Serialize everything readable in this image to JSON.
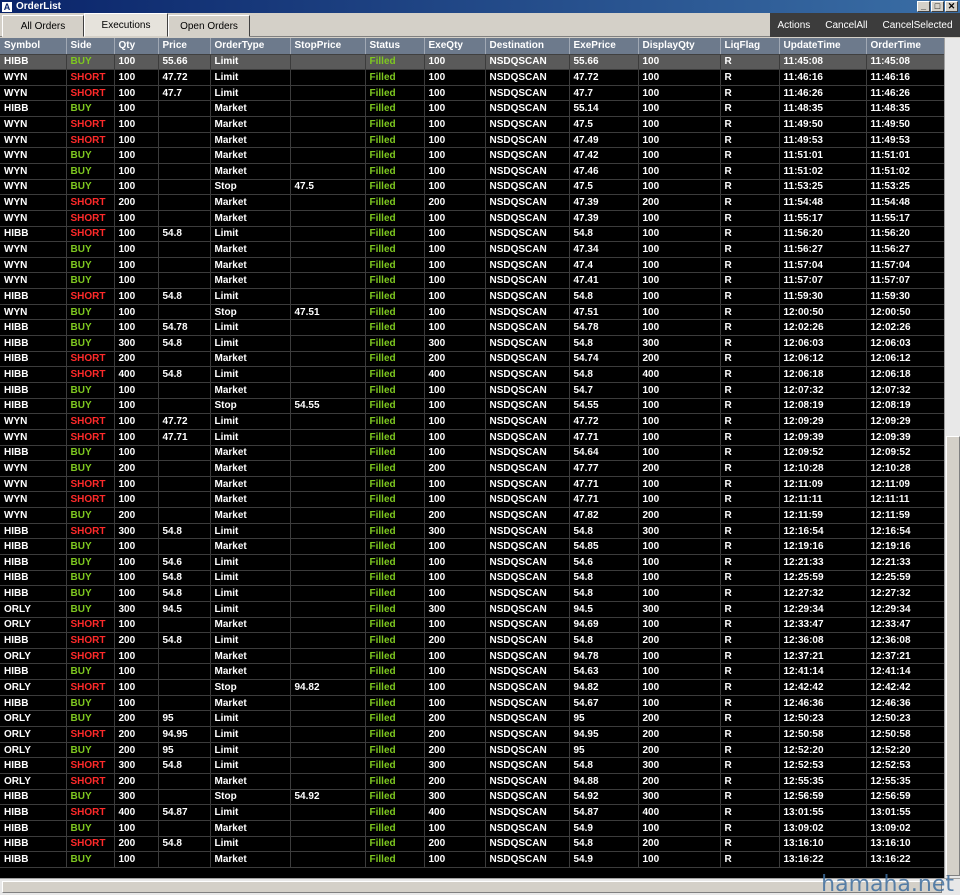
{
  "window": {
    "title": "OrderList",
    "icon": "A"
  },
  "tabs": [
    {
      "label": "All Orders"
    },
    {
      "label": "Executions"
    },
    {
      "label": "Open Orders"
    }
  ],
  "actions": [
    "Actions",
    "CancelAll",
    "CancelSelected"
  ],
  "columns": [
    "Symbol",
    "Side",
    "Qty",
    "Price",
    "OrderType",
    "StopPrice",
    "Status",
    "ExeQty",
    "Destination",
    "ExePrice",
    "DisplayQty",
    "LiqFlag",
    "UpdateTime",
    "OrderTime"
  ],
  "rows": [
    [
      "HIBB",
      "BUY",
      "100",
      "55.66",
      "Limit",
      "",
      "Filled",
      "100",
      "NSDQSCAN",
      "55.66",
      "100",
      "R",
      "11:45:08",
      "11:45:08"
    ],
    [
      "WYN",
      "SHORT",
      "100",
      "47.72",
      "Limit",
      "",
      "Filled",
      "100",
      "NSDQSCAN",
      "47.72",
      "100",
      "R",
      "11:46:16",
      "11:46:16"
    ],
    [
      "WYN",
      "SHORT",
      "100",
      "47.7",
      "Limit",
      "",
      "Filled",
      "100",
      "NSDQSCAN",
      "47.7",
      "100",
      "R",
      "11:46:26",
      "11:46:26"
    ],
    [
      "HIBB",
      "BUY",
      "100",
      "",
      "Market",
      "",
      "Filled",
      "100",
      "NSDQSCAN",
      "55.14",
      "100",
      "R",
      "11:48:35",
      "11:48:35"
    ],
    [
      "WYN",
      "SHORT",
      "100",
      "",
      "Market",
      "",
      "Filled",
      "100",
      "NSDQSCAN",
      "47.5",
      "100",
      "R",
      "11:49:50",
      "11:49:50"
    ],
    [
      "WYN",
      "SHORT",
      "100",
      "",
      "Market",
      "",
      "Filled",
      "100",
      "NSDQSCAN",
      "47.49",
      "100",
      "R",
      "11:49:53",
      "11:49:53"
    ],
    [
      "WYN",
      "BUY",
      "100",
      "",
      "Market",
      "",
      "Filled",
      "100",
      "NSDQSCAN",
      "47.42",
      "100",
      "R",
      "11:51:01",
      "11:51:01"
    ],
    [
      "WYN",
      "BUY",
      "100",
      "",
      "Market",
      "",
      "Filled",
      "100",
      "NSDQSCAN",
      "47.46",
      "100",
      "R",
      "11:51:02",
      "11:51:02"
    ],
    [
      "WYN",
      "BUY",
      "100",
      "",
      "Stop",
      "47.5",
      "Filled",
      "100",
      "NSDQSCAN",
      "47.5",
      "100",
      "R",
      "11:53:25",
      "11:53:25"
    ],
    [
      "WYN",
      "SHORT",
      "200",
      "",
      "Market",
      "",
      "Filled",
      "200",
      "NSDQSCAN",
      "47.39",
      "200",
      "R",
      "11:54:48",
      "11:54:48"
    ],
    [
      "WYN",
      "SHORT",
      "100",
      "",
      "Market",
      "",
      "Filled",
      "100",
      "NSDQSCAN",
      "47.39",
      "100",
      "R",
      "11:55:17",
      "11:55:17"
    ],
    [
      "HIBB",
      "SHORT",
      "100",
      "54.8",
      "Limit",
      "",
      "Filled",
      "100",
      "NSDQSCAN",
      "54.8",
      "100",
      "R",
      "11:56:20",
      "11:56:20"
    ],
    [
      "WYN",
      "BUY",
      "100",
      "",
      "Market",
      "",
      "Filled",
      "100",
      "NSDQSCAN",
      "47.34",
      "100",
      "R",
      "11:56:27",
      "11:56:27"
    ],
    [
      "WYN",
      "BUY",
      "100",
      "",
      "Market",
      "",
      "Filled",
      "100",
      "NSDQSCAN",
      "47.4",
      "100",
      "R",
      "11:57:04",
      "11:57:04"
    ],
    [
      "WYN",
      "BUY",
      "100",
      "",
      "Market",
      "",
      "Filled",
      "100",
      "NSDQSCAN",
      "47.41",
      "100",
      "R",
      "11:57:07",
      "11:57:07"
    ],
    [
      "HIBB",
      "SHORT",
      "100",
      "54.8",
      "Limit",
      "",
      "Filled",
      "100",
      "NSDQSCAN",
      "54.8",
      "100",
      "R",
      "11:59:30",
      "11:59:30"
    ],
    [
      "WYN",
      "BUY",
      "100",
      "",
      "Stop",
      "47.51",
      "Filled",
      "100",
      "NSDQSCAN",
      "47.51",
      "100",
      "R",
      "12:00:50",
      "12:00:50"
    ],
    [
      "HIBB",
      "BUY",
      "100",
      "54.78",
      "Limit",
      "",
      "Filled",
      "100",
      "NSDQSCAN",
      "54.78",
      "100",
      "R",
      "12:02:26",
      "12:02:26"
    ],
    [
      "HIBB",
      "BUY",
      "300",
      "54.8",
      "Limit",
      "",
      "Filled",
      "300",
      "NSDQSCAN",
      "54.8",
      "300",
      "R",
      "12:06:03",
      "12:06:03"
    ],
    [
      "HIBB",
      "SHORT",
      "200",
      "",
      "Market",
      "",
      "Filled",
      "200",
      "NSDQSCAN",
      "54.74",
      "200",
      "R",
      "12:06:12",
      "12:06:12"
    ],
    [
      "HIBB",
      "SHORT",
      "400",
      "54.8",
      "Limit",
      "",
      "Filled",
      "400",
      "NSDQSCAN",
      "54.8",
      "400",
      "R",
      "12:06:18",
      "12:06:18"
    ],
    [
      "HIBB",
      "BUY",
      "100",
      "",
      "Market",
      "",
      "Filled",
      "100",
      "NSDQSCAN",
      "54.7",
      "100",
      "R",
      "12:07:32",
      "12:07:32"
    ],
    [
      "HIBB",
      "BUY",
      "100",
      "",
      "Stop",
      "54.55",
      "Filled",
      "100",
      "NSDQSCAN",
      "54.55",
      "100",
      "R",
      "12:08:19",
      "12:08:19"
    ],
    [
      "WYN",
      "SHORT",
      "100",
      "47.72",
      "Limit",
      "",
      "Filled",
      "100",
      "NSDQSCAN",
      "47.72",
      "100",
      "R",
      "12:09:29",
      "12:09:29"
    ],
    [
      "WYN",
      "SHORT",
      "100",
      "47.71",
      "Limit",
      "",
      "Filled",
      "100",
      "NSDQSCAN",
      "47.71",
      "100",
      "R",
      "12:09:39",
      "12:09:39"
    ],
    [
      "HIBB",
      "BUY",
      "100",
      "",
      "Market",
      "",
      "Filled",
      "100",
      "NSDQSCAN",
      "54.64",
      "100",
      "R",
      "12:09:52",
      "12:09:52"
    ],
    [
      "WYN",
      "BUY",
      "200",
      "",
      "Market",
      "",
      "Filled",
      "200",
      "NSDQSCAN",
      "47.77",
      "200",
      "R",
      "12:10:28",
      "12:10:28"
    ],
    [
      "WYN",
      "SHORT",
      "100",
      "",
      "Market",
      "",
      "Filled",
      "100",
      "NSDQSCAN",
      "47.71",
      "100",
      "R",
      "12:11:09",
      "12:11:09"
    ],
    [
      "WYN",
      "SHORT",
      "100",
      "",
      "Market",
      "",
      "Filled",
      "100",
      "NSDQSCAN",
      "47.71",
      "100",
      "R",
      "12:11:11",
      "12:11:11"
    ],
    [
      "WYN",
      "BUY",
      "200",
      "",
      "Market",
      "",
      "Filled",
      "200",
      "NSDQSCAN",
      "47.82",
      "200",
      "R",
      "12:11:59",
      "12:11:59"
    ],
    [
      "HIBB",
      "SHORT",
      "300",
      "54.8",
      "Limit",
      "",
      "Filled",
      "300",
      "NSDQSCAN",
      "54.8",
      "300",
      "R",
      "12:16:54",
      "12:16:54"
    ],
    [
      "HIBB",
      "BUY",
      "100",
      "",
      "Market",
      "",
      "Filled",
      "100",
      "NSDQSCAN",
      "54.85",
      "100",
      "R",
      "12:19:16",
      "12:19:16"
    ],
    [
      "HIBB",
      "BUY",
      "100",
      "54.6",
      "Limit",
      "",
      "Filled",
      "100",
      "NSDQSCAN",
      "54.6",
      "100",
      "R",
      "12:21:33",
      "12:21:33"
    ],
    [
      "HIBB",
      "BUY",
      "100",
      "54.8",
      "Limit",
      "",
      "Filled",
      "100",
      "NSDQSCAN",
      "54.8",
      "100",
      "R",
      "12:25:59",
      "12:25:59"
    ],
    [
      "HIBB",
      "BUY",
      "100",
      "54.8",
      "Limit",
      "",
      "Filled",
      "100",
      "NSDQSCAN",
      "54.8",
      "100",
      "R",
      "12:27:32",
      "12:27:32"
    ],
    [
      "ORLY",
      "BUY",
      "300",
      "94.5",
      "Limit",
      "",
      "Filled",
      "300",
      "NSDQSCAN",
      "94.5",
      "300",
      "R",
      "12:29:34",
      "12:29:34"
    ],
    [
      "ORLY",
      "SHORT",
      "100",
      "",
      "Market",
      "",
      "Filled",
      "100",
      "NSDQSCAN",
      "94.69",
      "100",
      "R",
      "12:33:47",
      "12:33:47"
    ],
    [
      "HIBB",
      "SHORT",
      "200",
      "54.8",
      "Limit",
      "",
      "Filled",
      "200",
      "NSDQSCAN",
      "54.8",
      "200",
      "R",
      "12:36:08",
      "12:36:08"
    ],
    [
      "ORLY",
      "SHORT",
      "100",
      "",
      "Market",
      "",
      "Filled",
      "100",
      "NSDQSCAN",
      "94.78",
      "100",
      "R",
      "12:37:21",
      "12:37:21"
    ],
    [
      "HIBB",
      "BUY",
      "100",
      "",
      "Market",
      "",
      "Filled",
      "100",
      "NSDQSCAN",
      "54.63",
      "100",
      "R",
      "12:41:14",
      "12:41:14"
    ],
    [
      "ORLY",
      "SHORT",
      "100",
      "",
      "Stop",
      "94.82",
      "Filled",
      "100",
      "NSDQSCAN",
      "94.82",
      "100",
      "R",
      "12:42:42",
      "12:42:42"
    ],
    [
      "HIBB",
      "BUY",
      "100",
      "",
      "Market",
      "",
      "Filled",
      "100",
      "NSDQSCAN",
      "54.67",
      "100",
      "R",
      "12:46:36",
      "12:46:36"
    ],
    [
      "ORLY",
      "BUY",
      "200",
      "95",
      "Limit",
      "",
      "Filled",
      "200",
      "NSDQSCAN",
      "95",
      "200",
      "R",
      "12:50:23",
      "12:50:23"
    ],
    [
      "ORLY",
      "SHORT",
      "200",
      "94.95",
      "Limit",
      "",
      "Filled",
      "200",
      "NSDQSCAN",
      "94.95",
      "200",
      "R",
      "12:50:58",
      "12:50:58"
    ],
    [
      "ORLY",
      "BUY",
      "200",
      "95",
      "Limit",
      "",
      "Filled",
      "200",
      "NSDQSCAN",
      "95",
      "200",
      "R",
      "12:52:20",
      "12:52:20"
    ],
    [
      "HIBB",
      "SHORT",
      "300",
      "54.8",
      "Limit",
      "",
      "Filled",
      "300",
      "NSDQSCAN",
      "54.8",
      "300",
      "R",
      "12:52:53",
      "12:52:53"
    ],
    [
      "ORLY",
      "SHORT",
      "200",
      "",
      "Market",
      "",
      "Filled",
      "200",
      "NSDQSCAN",
      "94.88",
      "200",
      "R",
      "12:55:35",
      "12:55:35"
    ],
    [
      "HIBB",
      "BUY",
      "300",
      "",
      "Stop",
      "54.92",
      "Filled",
      "300",
      "NSDQSCAN",
      "54.92",
      "300",
      "R",
      "12:56:59",
      "12:56:59"
    ],
    [
      "HIBB",
      "SHORT",
      "400",
      "54.87",
      "Limit",
      "",
      "Filled",
      "400",
      "NSDQSCAN",
      "54.87",
      "400",
      "R",
      "13:01:55",
      "13:01:55"
    ],
    [
      "HIBB",
      "BUY",
      "100",
      "",
      "Market",
      "",
      "Filled",
      "100",
      "NSDQSCAN",
      "54.9",
      "100",
      "R",
      "13:09:02",
      "13:09:02"
    ],
    [
      "HIBB",
      "SHORT",
      "200",
      "54.8",
      "Limit",
      "",
      "Filled",
      "200",
      "NSDQSCAN",
      "54.8",
      "200",
      "R",
      "13:16:10",
      "13:16:10"
    ],
    [
      "HIBB",
      "BUY",
      "100",
      "",
      "Market",
      "",
      "Filled",
      "100",
      "NSDQSCAN",
      "54.9",
      "100",
      "R",
      "13:16:22",
      "13:16:22"
    ]
  ],
  "colors": {
    "buy": "#7ec820",
    "short": "#ff2a2a",
    "filled": "#7ec820",
    "header_bg": "#6d7a8c"
  },
  "watermark": "hamaha.net"
}
